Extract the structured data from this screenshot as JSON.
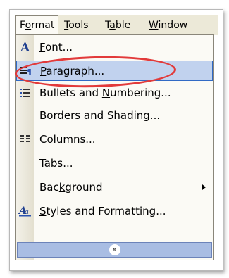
{
  "menubar": {
    "items": [
      {
        "pre": "F",
        "u": "o",
        "post": "rmat"
      },
      {
        "pre": "",
        "u": "T",
        "post": "ools"
      },
      {
        "pre": "T",
        "u": "a",
        "post": "ble"
      },
      {
        "pre": "",
        "u": "W",
        "post": "indow"
      }
    ]
  },
  "menu": {
    "items": [
      {
        "pre": "",
        "u": "F",
        "post": "ont...",
        "icon": "font-icon"
      },
      {
        "pre": "",
        "u": "P",
        "post": "aragraph...",
        "icon": "paragraph-icon"
      },
      {
        "pre": "Bullets and ",
        "u": "N",
        "post": "umbering...",
        "icon": "bullets-icon"
      },
      {
        "pre": "",
        "u": "B",
        "post": "orders and Shading...",
        "icon": ""
      },
      {
        "pre": "",
        "u": "C",
        "post": "olumns...",
        "icon": "columns-icon"
      },
      {
        "pre": "",
        "u": "T",
        "post": "abs...",
        "icon": ""
      },
      {
        "pre": "Bac",
        "u": "k",
        "post": "ground",
        "icon": "",
        "submenu": true
      },
      {
        "pre": "",
        "u": "S",
        "post": "tyles and Formatting...",
        "icon": "styles-icon"
      }
    ],
    "expand_glyph": "»"
  },
  "colors": {
    "menubar_bg": "#ece9d8",
    "menu_bg": "#fbfaf5",
    "highlight": "#c1d2ee",
    "annotation": "#e23a3a"
  }
}
